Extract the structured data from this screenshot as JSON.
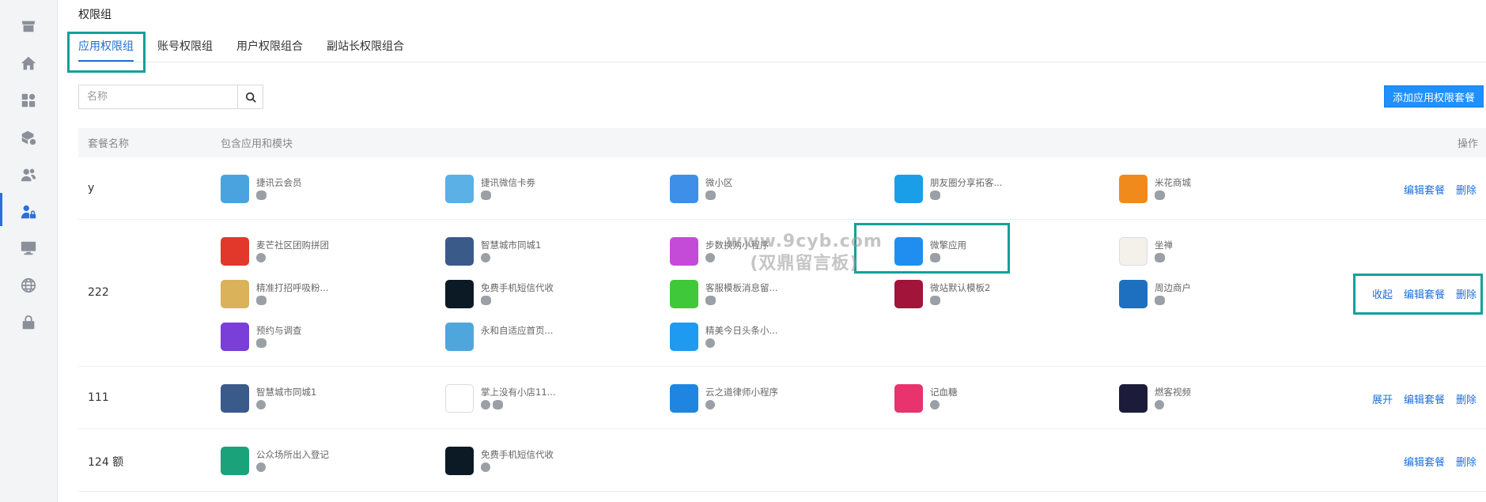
{
  "sidebar": {
    "items": [
      {
        "icon": "store-icon"
      },
      {
        "icon": "home-icon"
      },
      {
        "icon": "apps-grid-icon"
      },
      {
        "icon": "package-settings-icon"
      },
      {
        "icon": "users-icon"
      },
      {
        "icon": "user-lock-icon",
        "active": true
      },
      {
        "icon": "monitor-icon"
      },
      {
        "icon": "globe-icon"
      },
      {
        "icon": "lock-icon"
      }
    ],
    "accent": "#2a6fdb"
  },
  "page": {
    "title": "权限组"
  },
  "tabs": [
    {
      "label": "应用权限组",
      "active": true
    },
    {
      "label": "账号权限组"
    },
    {
      "label": "用户权限组合"
    },
    {
      "label": "副站长权限组合"
    }
  ],
  "search": {
    "placeholder": "名称",
    "value": ""
  },
  "toolbar": {
    "add_label": "添加应用权限套餐"
  },
  "table": {
    "headers": {
      "name": "套餐名称",
      "apps": "包含应用和模块",
      "ops": "操作"
    },
    "rows": [
      {
        "name": "y",
        "apps": [
          {
            "name": "捷讯云会员",
            "color": "#4aa3df",
            "tags": [
              "wx"
            ]
          },
          {
            "name": "捷讯微信卡劵",
            "color": "#5bb0e6",
            "tags": [
              "wx"
            ]
          },
          {
            "name": "微小区",
            "color": "#3d8fe8",
            "tags": [
              "wx"
            ]
          },
          {
            "name": "朋友圈分享拓客...",
            "color": "#1a9ee8",
            "tags": [
              "wx"
            ]
          },
          {
            "name": "米花商城",
            "color": "#f08a1c",
            "tags": [
              "wx"
            ]
          }
        ],
        "ops": [
          "编辑套餐",
          "删除"
        ]
      },
      {
        "name": "222",
        "apps": [
          {
            "name": "麦芒社区团购拼团",
            "color": "#e2372b",
            "tags": [
              "mp"
            ]
          },
          {
            "name": "智慧城市同城1",
            "color": "#3a5a8a",
            "tags": [
              "mp"
            ]
          },
          {
            "name": "步数换购小程序",
            "color": "#c44bd8",
            "tags": [
              "mp"
            ]
          },
          {
            "name": "微擎应用",
            "color": "#1f8ef0",
            "tags": [
              "wx"
            ]
          },
          {
            "name": "坐禅",
            "color": "#f4f0ea",
            "tags": [
              "wx"
            ]
          },
          {
            "name": "精准打招呼吸粉...",
            "color": "#d9b25a",
            "tags": [
              "wx"
            ]
          },
          {
            "name": "免费手机短信代收",
            "color": "#0c1a26",
            "tags": [
              "wx"
            ]
          },
          {
            "name": "客服模板消息留...",
            "color": "#3fc83a",
            "tags": [
              "wx"
            ]
          },
          {
            "name": "微站默认模板2",
            "color": "#a3143a",
            "tags": [
              "wx"
            ]
          },
          {
            "name": "周边商户",
            "color": "#1d6fc0",
            "tags": [
              "wx"
            ]
          },
          {
            "name": "预约与调查",
            "color": "#7a3fd8",
            "tags": [
              "wx"
            ]
          },
          {
            "name": "永和自适应首页...",
            "color": "#4fa6dc",
            "tags": []
          },
          {
            "name": "精美今日头条小...",
            "color": "#1e9bf0",
            "tags": [
              "mp"
            ]
          }
        ],
        "ops": [
          "收起",
          "编辑套餐",
          "删除"
        ]
      },
      {
        "name": "111",
        "apps": [
          {
            "name": "智慧城市同城1",
            "color": "#3a5a8a",
            "tags": [
              "mp"
            ]
          },
          {
            "name": "掌上没有小店11...",
            "color": "#ffffff",
            "tags": [
              "mp",
              "wx"
            ]
          },
          {
            "name": "云之道律师小程序",
            "color": "#1e86e0",
            "tags": [
              "mp"
            ]
          },
          {
            "name": "记血糖",
            "color": "#e8336f",
            "tags": [
              "mp"
            ]
          },
          {
            "name": "燃客视频",
            "color": "#1c1c3a",
            "tags": [
              "mp"
            ]
          }
        ],
        "ops": [
          "展开",
          "编辑套餐",
          "删除"
        ]
      },
      {
        "name": "124 额",
        "apps": [
          {
            "name": "公众场所出入登记",
            "color": "#1aa37a",
            "tags": [
              "mp"
            ]
          },
          {
            "name": "免费手机短信代收",
            "color": "#0c1a26",
            "tags": [
              "mp"
            ]
          }
        ],
        "ops": [
          "编辑套餐",
          "删除"
        ]
      }
    ]
  },
  "watermark": {
    "line1": "www.9cyb.com",
    "line2": "(双鼎留言板)"
  }
}
